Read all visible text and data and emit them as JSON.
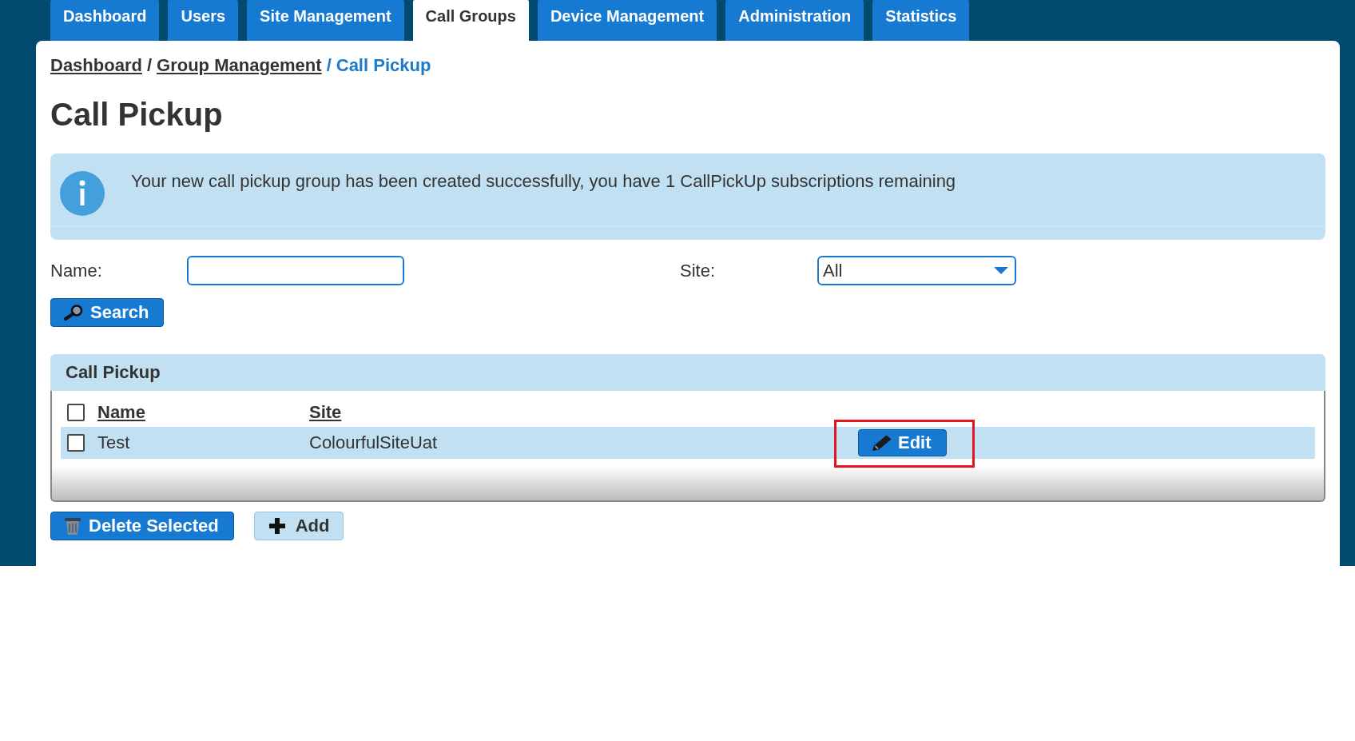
{
  "nav_tabs": [
    {
      "label": "Dashboard",
      "selected": false
    },
    {
      "label": "Users",
      "selected": false
    },
    {
      "label": "Site Management",
      "selected": false
    },
    {
      "label": "Call Groups",
      "selected": true
    },
    {
      "label": "Device Management",
      "selected": false
    },
    {
      "label": "Administration",
      "selected": false
    },
    {
      "label": "Statistics",
      "selected": false
    }
  ],
  "breadcrumb": [
    {
      "kind": "link",
      "label": "Dashboard"
    },
    {
      "kind": "separator",
      "label": "/"
    },
    {
      "kind": "link",
      "label": "Group Management"
    },
    {
      "kind": "separator",
      "label": "/"
    },
    {
      "kind": "current",
      "label": "Call Pickup"
    }
  ],
  "page_title": "Call Pickup",
  "alert": {
    "kind": "info",
    "message": "Your new call pickup group has been created successfully, you have 1 CallPickUp subscriptions remaining"
  },
  "filters": {
    "name": {
      "label": "Name:"
    },
    "site": {
      "label": "Site:",
      "value": "All"
    }
  },
  "search_button": {
    "label": "Search"
  },
  "table": {
    "title": "Call Pickup",
    "select_all": {
      "checked": false
    },
    "columns": [
      {
        "label": "Name"
      },
      {
        "label": "Site"
      }
    ],
    "rows": [
      {
        "checked": false,
        "cells": [
          "Test",
          "ColourfulSiteUat"
        ],
        "action": {
          "label": "Edit",
          "highlighted": true
        }
      }
    ]
  },
  "actions": [
    {
      "kind": "delete",
      "label": "Delete Selected"
    },
    {
      "kind": "add",
      "label": "Add"
    }
  ]
}
